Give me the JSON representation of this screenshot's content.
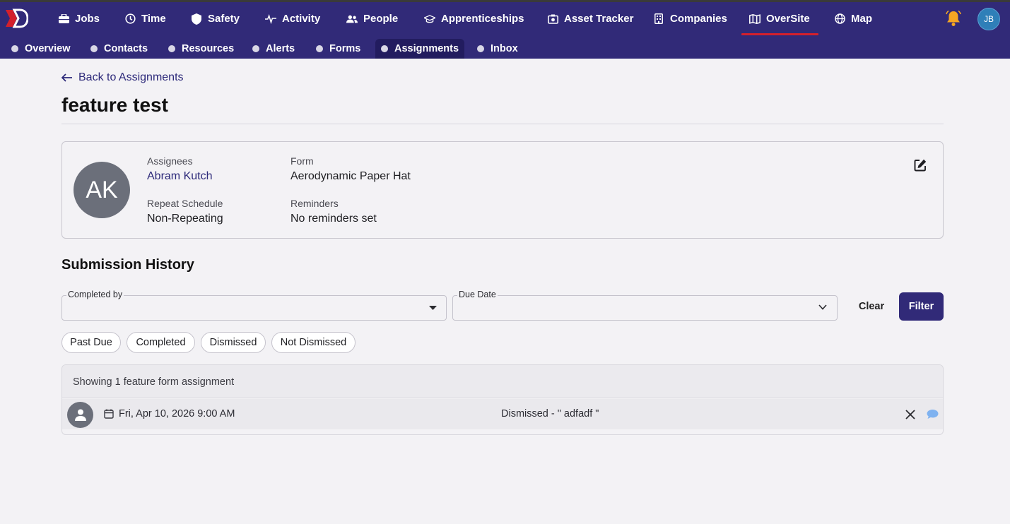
{
  "nav": {
    "items": [
      {
        "label": "Jobs",
        "icon": "briefcase-icon"
      },
      {
        "label": "Time",
        "icon": "clock-icon"
      },
      {
        "label": "Safety",
        "icon": "shield-icon"
      },
      {
        "label": "Activity",
        "icon": "activity-icon"
      },
      {
        "label": "People",
        "icon": "people-icon"
      },
      {
        "label": "Apprenticeships",
        "icon": "graduation-cap-icon"
      },
      {
        "label": "Asset Tracker",
        "icon": "asset-icon"
      },
      {
        "label": "Companies",
        "icon": "building-icon"
      },
      {
        "label": "OverSite",
        "icon": "map-fold-icon",
        "active": true
      },
      {
        "label": "Map",
        "icon": "globe-icon"
      }
    ],
    "user_initials": "JB"
  },
  "subnav": {
    "items": [
      "Overview",
      "Contacts",
      "Resources",
      "Alerts",
      "Forms",
      "Assignments",
      "Inbox"
    ],
    "active": "Assignments"
  },
  "back_link": "Back to Assignments",
  "page_title": "feature test",
  "details": {
    "avatar_initials": "AK",
    "assignees_label": "Assignees",
    "assignees_value": "Abram Kutch",
    "form_label": "Form",
    "form_value": "Aerodynamic Paper Hat",
    "repeat_label": "Repeat Schedule",
    "repeat_value": "Non-Repeating",
    "reminders_label": "Reminders",
    "reminders_value": "No reminders set"
  },
  "history": {
    "title": "Submission History",
    "completed_by_label": "Completed by",
    "completed_by_value": "",
    "due_date_label": "Due Date",
    "due_date_value": "",
    "clear_label": "Clear",
    "filter_label": "Filter",
    "chips": [
      "Past Due",
      "Completed",
      "Dismissed",
      "Not Dismissed"
    ],
    "showing_text": "Showing 1 feature form assignment",
    "rows": [
      {
        "date": "Fri, Apr 10, 2026 9:00 AM",
        "status": "Dismissed - \" adfadf \""
      }
    ]
  },
  "colors": {
    "nav_bg": "#312a78",
    "active_underline": "#d3202c",
    "link": "#2d2a7a",
    "bell": "#f5a623",
    "comment_icon": "#7fb2f0"
  }
}
